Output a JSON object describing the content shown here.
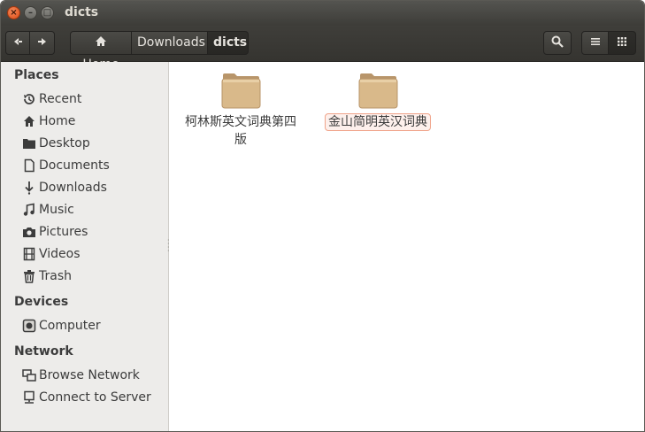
{
  "window": {
    "title": "dicts"
  },
  "titlebar": {
    "close_glyph": "×",
    "min_glyph": "–",
    "max_glyph": "□"
  },
  "toolbar": {
    "back_glyph": "◀",
    "forward_glyph": "▶",
    "breadcrumb": [
      {
        "label": "Home",
        "icon": "home-icon"
      },
      {
        "label": "Downloads"
      },
      {
        "label": "dicts",
        "current": true
      }
    ],
    "icons": [
      "search-icon",
      "list-view-icon",
      "grid-view-icon"
    ]
  },
  "sidebar": {
    "places_header": "Places",
    "places": [
      {
        "label": "Recent",
        "icon": "recent-icon"
      },
      {
        "label": "Home",
        "icon": "home-icon"
      },
      {
        "label": "Desktop",
        "icon": "desktop-icon"
      },
      {
        "label": "Documents",
        "icon": "document-icon"
      },
      {
        "label": "Downloads",
        "icon": "download-icon"
      },
      {
        "label": "Music",
        "icon": "music-icon"
      },
      {
        "label": "Pictures",
        "icon": "camera-icon"
      },
      {
        "label": "Videos",
        "icon": "film-icon"
      },
      {
        "label": "Trash",
        "icon": "trash-icon"
      }
    ],
    "devices_header": "Devices",
    "devices": [
      {
        "label": "Computer",
        "icon": "drive-icon"
      }
    ],
    "network_header": "Network",
    "network": [
      {
        "label": "Browse Network",
        "icon": "network-icon"
      },
      {
        "label": "Connect to Server",
        "icon": "server-icon"
      }
    ]
  },
  "files": [
    {
      "name_line1": "柯林斯英文词典第四",
      "name_line2": "版",
      "selected": false
    },
    {
      "name_line1": "金山简明英汉词典",
      "selected": true
    }
  ],
  "colors": {
    "folder": "#d9b98a",
    "selection_border": "#f0a48a",
    "titlebar": "#3d3c38"
  }
}
